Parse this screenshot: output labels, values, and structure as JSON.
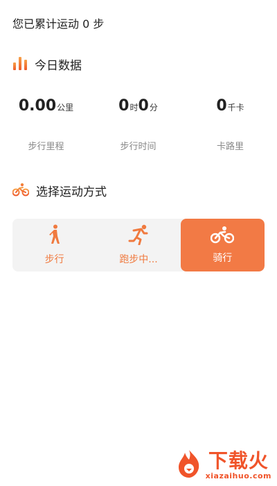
{
  "header": {
    "total_steps_text": "您已累计运动 0 步"
  },
  "today": {
    "title": "今日数据",
    "icon": "bar-chart-icon",
    "distance": {
      "value": "0.00",
      "unit": "公里",
      "label": "步行里程"
    },
    "duration": {
      "hours": "0",
      "hours_unit": "时",
      "minutes": "0",
      "minutes_unit": "分",
      "label": "步行时间"
    },
    "calories": {
      "value": "0",
      "unit": "千卡",
      "label": "卡路里"
    }
  },
  "choose": {
    "title": "选择运动方式",
    "icon": "bicycle-icon",
    "modes": [
      {
        "label": "步行",
        "icon": "walking-icon",
        "selected": false
      },
      {
        "label": "跑步中...",
        "icon": "running-icon",
        "selected": false
      },
      {
        "label": "骑行",
        "icon": "bicycle-icon",
        "selected": true
      }
    ]
  },
  "watermark": {
    "cn": "下载火",
    "en": "xiazaihuo.com",
    "icon": "flame-icon"
  },
  "colors": {
    "accent": "#f27a45",
    "accent_text": "#f07a3f",
    "panel_bg": "#f3f3f3"
  }
}
